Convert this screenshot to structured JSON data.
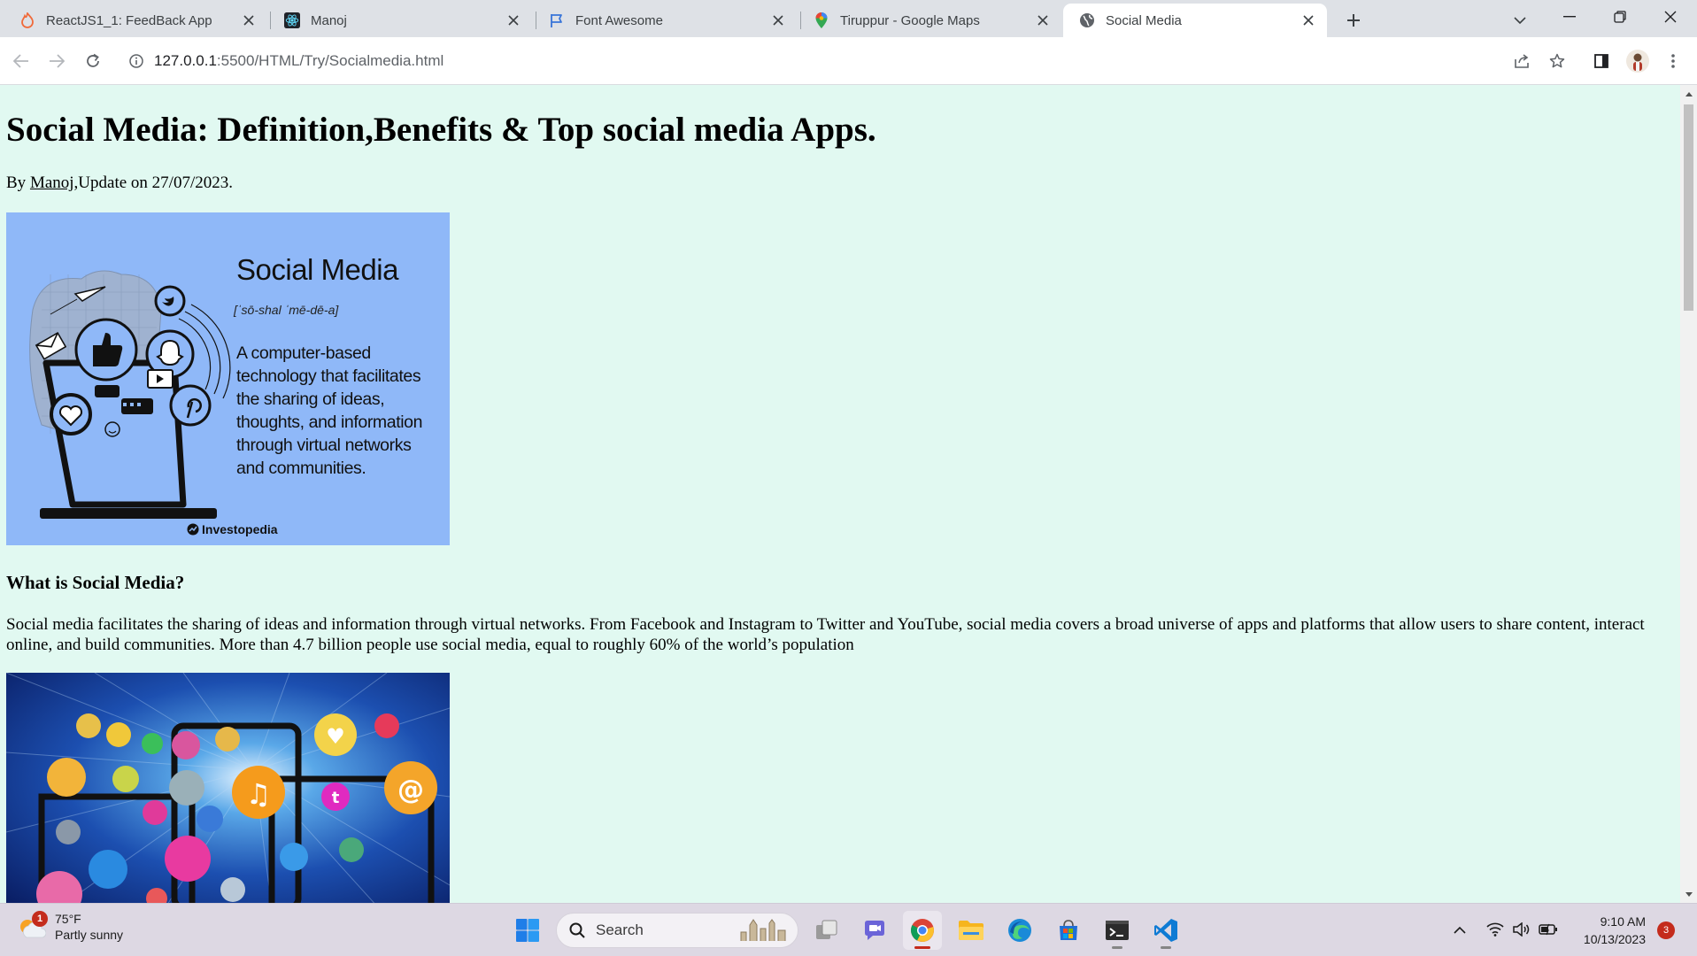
{
  "browser": {
    "tabs": [
      {
        "title": "ReactJS1_1: FeedBack App",
        "icon": "flame-icon",
        "active": false
      },
      {
        "title": "Manoj",
        "icon": "react-icon",
        "active": false
      },
      {
        "title": "Font Awesome",
        "icon": "flag-icon",
        "active": false
      },
      {
        "title": "Tiruppur - Google Maps",
        "icon": "maps-pin-icon",
        "active": false
      },
      {
        "title": "Social Media",
        "icon": "globe-icon",
        "active": true
      }
    ],
    "url": {
      "host": "127.0.0.1",
      "path": ":5500/HTML/Try/Socialmedia.html"
    }
  },
  "page": {
    "title": "Social Media: Definition,Benefits & Top social media Apps.",
    "byline": {
      "prefix": "By ",
      "author": "Manoj",
      "suffix": ",Update on 27/07/2023."
    },
    "hero_image": {
      "heading": "Social Media",
      "pronunciation": "[ˈsō-shal ˈmē-dē-a]",
      "definition": "A computer-based technology that facilitates the sharing of ideas, thoughts, and information through virtual networks and communities.",
      "credit": "Investopedia"
    },
    "section_heading": "What is Social Media?",
    "section_paragraph": "Social media facilitates the sharing of ideas and information through virtual networks. From Facebook and Instagram to Twitter and YouTube, social media covers a broad universe of apps and platforms that allow users to share content, interact online, and build communities. More than 4.7 billion people use social media, equal to roughly 60% of the world’s population"
  },
  "taskbar": {
    "weather": {
      "temp": "75°F",
      "condition": "Partly sunny",
      "badge": "1"
    },
    "search_label": "Search",
    "clock": {
      "time": "9:10 AM",
      "date": "10/13/2023"
    },
    "notification_count": "3"
  },
  "colors": {
    "page_bg": "#e1f9f1",
    "hero_bg": "#8fb8f8"
  }
}
